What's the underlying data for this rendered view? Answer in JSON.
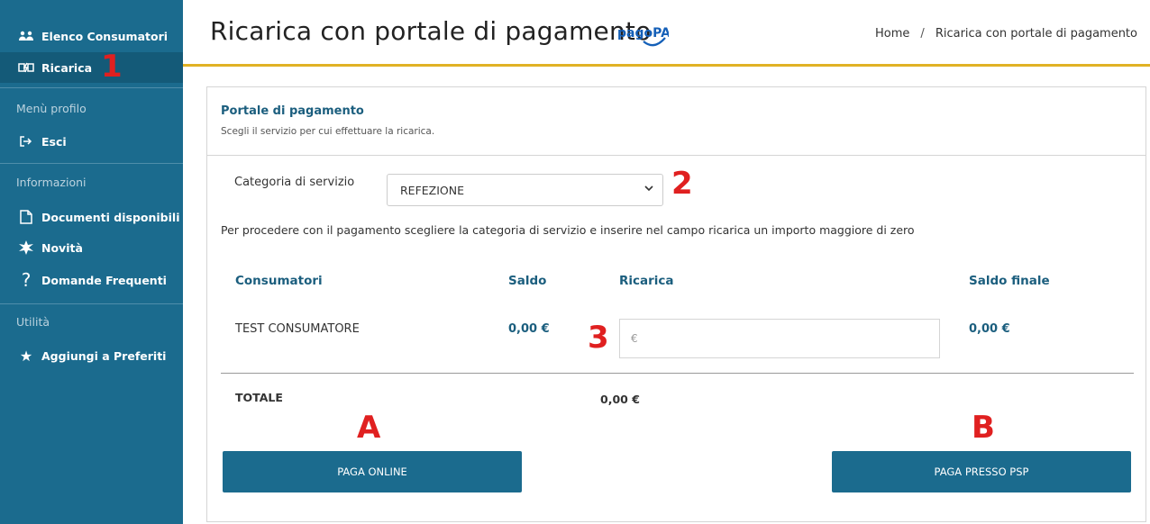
{
  "sidebar": {
    "items": [
      {
        "label": "Elenco Consumatori",
        "icon": "people-icon"
      },
      {
        "label": "Ricarica",
        "icon": "recharge-icon"
      }
    ],
    "profile_section": "Menù profilo",
    "profile_items": [
      {
        "label": "Esci",
        "icon": "logout-icon"
      }
    ],
    "info_section": "Informazioni",
    "info_items": [
      {
        "label": "Documenti disponibili",
        "icon": "document-icon"
      },
      {
        "label": "Novità",
        "icon": "news-icon"
      },
      {
        "label": "Domande Frequenti",
        "icon": "question-icon"
      }
    ],
    "util_section": "Utilità",
    "util_items": [
      {
        "label": "Aggiungi a Preferiti",
        "icon": "star-icon"
      }
    ]
  },
  "header": {
    "title": "Ricarica con portale di pagamento",
    "logo_text": "pagoPA",
    "breadcrumb": {
      "home": "Home",
      "separator": "/",
      "current": "Ricarica con portale di pagamento"
    }
  },
  "panel": {
    "title": "Portale di pagamento",
    "subtitle": "Scegli il servizio per cui effettuare la ricarica."
  },
  "form": {
    "category_label": "Categoria di servizio",
    "category_value": "REFEZIONE",
    "info": "Per procedere con il pagamento scegliere la categoria di servizio e inserire nel campo ricarica un importo maggiore di zero"
  },
  "table": {
    "headers": [
      "Consumatori",
      "Saldo",
      "Ricarica",
      "Saldo finale"
    ],
    "rows": [
      {
        "consumer": "TEST CONSUMATORE",
        "balance": "0,00 €",
        "recharge_placeholder": "€",
        "final_balance": "0,00 €"
      }
    ],
    "total_label": "TOTALE",
    "total_value": "0,00 €"
  },
  "buttons": {
    "pay_online": "PAGA ONLINE",
    "pay_psp": "PAGA PRESSO PSP"
  },
  "markers": [
    "1",
    "2",
    "3",
    "A",
    "B"
  ],
  "colors": {
    "sidebar": "#1b6b8e",
    "accent_line": "#e0b224",
    "heading": "#1b5e7e",
    "marker": "#e02020"
  }
}
